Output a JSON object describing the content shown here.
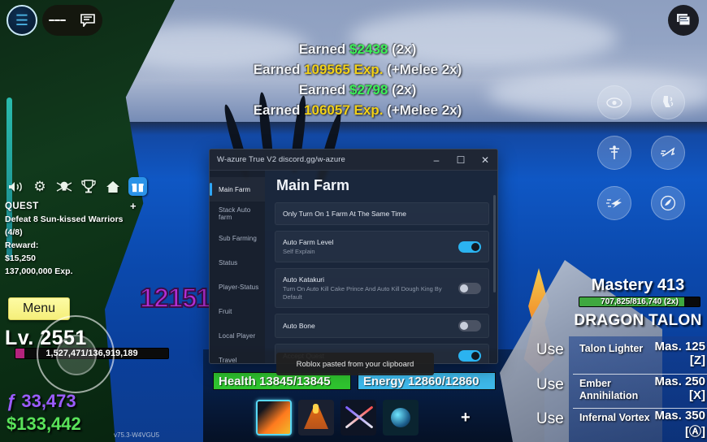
{
  "topbar": {
    "avatar_icon": "roblox-avatar-icon",
    "menu_icon": "hamburger-menu-icon",
    "chat_icon": "chat-bubble-icon",
    "window_switch_icon": "window-switcher-icon"
  },
  "earned_feed": [
    {
      "prefix": "Earned ",
      "value": "$2438",
      "value_type": "money",
      "suffix": " (2x)"
    },
    {
      "prefix": "Earned ",
      "value": "109565 Exp.",
      "value_type": "exp",
      "suffix": " (+Melee 2x)"
    },
    {
      "prefix": "Earned ",
      "value": "$2798",
      "value_type": "money",
      "suffix": " (2x)"
    },
    {
      "prefix": "Earned ",
      "value": "106057 Exp.",
      "value_type": "exp",
      "suffix": " (+Melee 2x)"
    }
  ],
  "icon_row": [
    {
      "name": "sound-icon",
      "glyph": "◂))",
      "active": false
    },
    {
      "name": "settings-gear-icon",
      "glyph": "⚙",
      "active": false
    },
    {
      "name": "pirate-skull-icon",
      "glyph": "☠",
      "active": false
    },
    {
      "name": "trophy-icon",
      "glyph": "⚱",
      "active": false
    },
    {
      "name": "home-icon",
      "glyph": "⌂",
      "active": false
    },
    {
      "name": "gift-icon",
      "glyph": "☗",
      "active": true
    }
  ],
  "quest": {
    "header": "QUEST",
    "plus": "+",
    "objective": "Defeat 8 Sun-kissed Warriors (4/8)",
    "reward_label": "Reward:",
    "reward_money": "$15,250",
    "reward_exp": "137,000,000 Exp."
  },
  "damage_number": "12151",
  "player": {
    "menu_label": "Menu",
    "level_label": "Lv. 2551",
    "xp_text": "1,527,471/136,919,189",
    "fragments": "ƒ 33,473",
    "cash": "$133,442",
    "version": "v75.3-W4VGU5",
    "health": "Health 13845/13845",
    "energy": "Energy 12860/12860"
  },
  "hotbar": {
    "slots": [
      {
        "name": "hotbar-slot-dragon-talon",
        "selected": true
      },
      {
        "name": "hotbar-slot-volcano",
        "selected": false
      },
      {
        "name": "hotbar-slot-swords",
        "selected": false
      },
      {
        "name": "hotbar-slot-orb",
        "selected": false
      }
    ],
    "add_label": "+"
  },
  "skill_icons": [
    {
      "name": "observation-eye-icon",
      "glyph": "◉"
    },
    {
      "name": "geppo-leg-icon",
      "glyph": "⮟"
    },
    {
      "name": "buso-haki-icon",
      "glyph": "⚔"
    },
    {
      "name": "soru-dash-icon",
      "glyph": "➤"
    },
    {
      "name": "flash-step-icon",
      "glyph": "✈"
    },
    {
      "name": "fruit-power-icon",
      "glyph": "☸"
    }
  ],
  "mastery": {
    "title": "Mastery 413",
    "bar_text": "707,825/816,740 (2x)",
    "weapon_name": "DRAGON TALON",
    "abilities": [
      {
        "use_label": "Use",
        "name": "Talon Lighter",
        "mastery": "Mas. 125",
        "key": "[Z]"
      },
      {
        "use_label": "Use",
        "name": "Ember Annihilation",
        "mastery": "Mas. 250",
        "key": "[X]"
      },
      {
        "use_label": "Use",
        "name": "Infernal Vortex",
        "mastery": "Mas. 350",
        "key": "[Ⓐ]"
      }
    ]
  },
  "script_window": {
    "title": "W-azure  True V2 discord.gg/w-azure",
    "controls": {
      "minimize": "–",
      "maximize": "☐",
      "close": "✕"
    },
    "sidebar": [
      {
        "label": "Main Farm",
        "active": true
      },
      {
        "label": "Stack Auto farm",
        "active": false
      },
      {
        "label": "Sub Farming",
        "active": false
      },
      {
        "label": "Status",
        "active": false
      },
      {
        "label": "Player-Status",
        "active": false
      },
      {
        "label": "Fruit",
        "active": false
      },
      {
        "label": "Local Player",
        "active": false
      },
      {
        "label": "Travel",
        "active": false
      }
    ],
    "heading": "Main Farm",
    "options": [
      {
        "title": "Only Turn On 1 Farm At The Same Time",
        "sub": "",
        "has_toggle": false,
        "toggle_on": false
      },
      {
        "title": "Auto Farm Level",
        "sub": "Self Explain",
        "has_toggle": true,
        "toggle_on": true
      },
      {
        "title": "Auto Katakuri",
        "sub": "Turn On Auto Kill Cake Prince And Auto Kill Dough King By Default",
        "has_toggle": true,
        "toggle_on": false
      },
      {
        "title": "Auto Bone",
        "sub": "",
        "has_toggle": true,
        "toggle_on": false
      },
      {
        "title": "Accept Quest",
        "sub": "",
        "has_toggle": true,
        "toggle_on": true
      }
    ]
  },
  "toast": {
    "message": "Roblox pasted from your clipboard"
  }
}
